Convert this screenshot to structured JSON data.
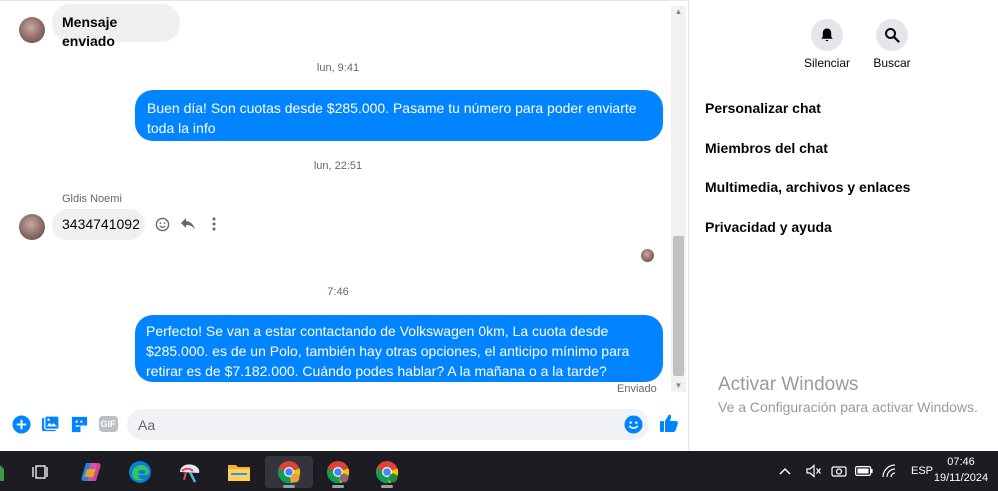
{
  "chat": {
    "messages": [
      {
        "id": "m1",
        "direction": "in",
        "text": "Mensaje enviado"
      },
      {
        "id": "t1",
        "type": "timestamp",
        "text": "lun, 9:41"
      },
      {
        "id": "m2",
        "direction": "out",
        "text": "Buen día! Son cuotas desde $285.000. Pasame tu número para poder enviarte toda la info"
      },
      {
        "id": "t2",
        "type": "timestamp",
        "text": "lun, 22:51"
      },
      {
        "id": "s1",
        "type": "sender",
        "text": "Gldis Noemi"
      },
      {
        "id": "m3",
        "direction": "in",
        "text": "3434741092"
      },
      {
        "id": "t3",
        "type": "timestamp",
        "text": "7:46"
      },
      {
        "id": "m4",
        "direction": "out",
        "text": "Perfecto!  Se van a estar contactando de Volkswagen 0km, La cuota desde $285.000. es de un Polo, también hay otras opciones, el anticipo mínimo para retirar es de $7.182.000. Cuándo podes hablar? A la mañana o a la tarde?"
      }
    ],
    "status": "Enviado",
    "composer": {
      "placeholder": "Aa",
      "icons": [
        "plus-circle-icon",
        "image-icon",
        "sticker-icon",
        "gif-icon",
        "emoji-icon",
        "thumbs-up-icon"
      ],
      "gif_label": "GIF"
    }
  },
  "panel": {
    "actions": [
      {
        "label": "Silenciar",
        "icon": "bell-icon"
      },
      {
        "label": "Buscar",
        "icon": "search-icon"
      }
    ],
    "menu": [
      "Personalizar chat",
      "Miembros del chat",
      "Multimedia, archivos y enlaces",
      "Privacidad y ayuda"
    ],
    "watermark": {
      "title": "Activar Windows",
      "subtitle": "Ve a Configuración para activar Windows."
    }
  },
  "taskbar": {
    "language": "ESP",
    "time": "07:46",
    "date": "19/11/2024"
  },
  "colors": {
    "accent": "#0084ff",
    "bubble_in": "#f0f0f0",
    "taskbar": "#1c1c22"
  }
}
